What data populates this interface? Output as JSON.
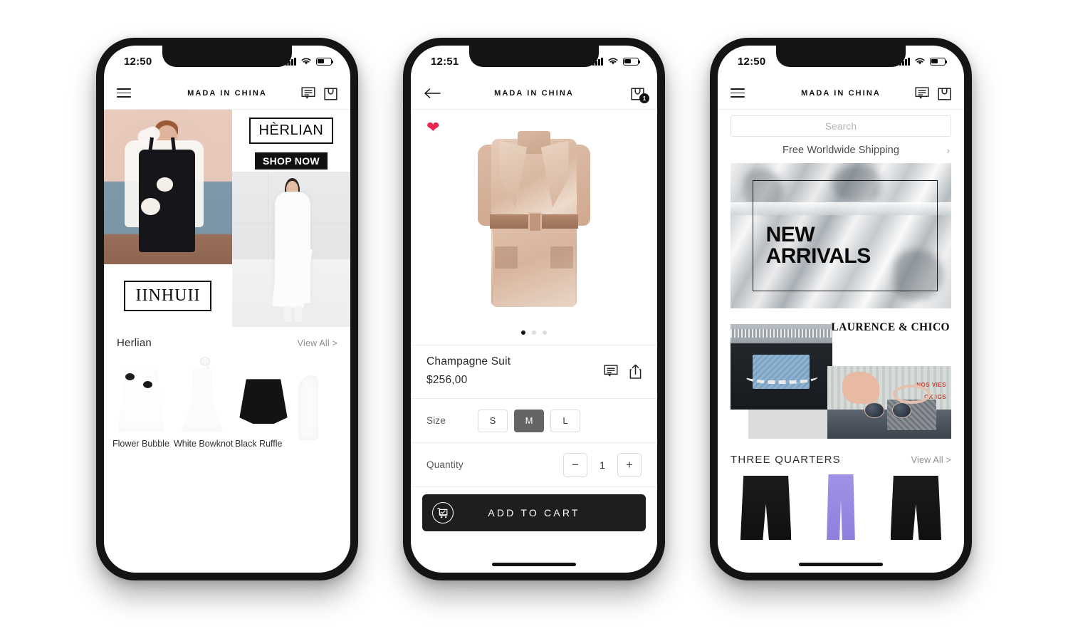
{
  "app": {
    "brand": "MADA IN CHINA"
  },
  "phones": [
    {
      "id": "home",
      "status": {
        "time": "12:50",
        "signal_icon": "cellular-signal-icon",
        "wifi_icon": "wifi-icon",
        "battery_icon": "battery-icon"
      },
      "nav": {
        "menu_icon": "hamburger-menu-icon",
        "brand": "MADA IN CHINA",
        "chat_icon": "chat-bubble-icon",
        "bag_icon": "shopping-bag-icon"
      },
      "hero": {
        "brand_badge": "HÈRLIAN",
        "shop_now": "SHOP NOW",
        "brand_badge_2": "IINHUII",
        "image_1_alt": "model-black-pinafore-dress",
        "image_2_alt": "model-white-ruffle-dress"
      },
      "section": {
        "title": "Herlian",
        "view_all": "View All >",
        "products": [
          {
            "name": "Flower Bubble",
            "image_alt": "white-puff-sleeve-dress"
          },
          {
            "name": "White Bowknot",
            "image_alt": "white-bow-strap-dress"
          },
          {
            "name": "Black Ruffle",
            "image_alt": "black-ruffle-skirt"
          },
          {
            "name": "",
            "image_alt": "white-dress-partial"
          }
        ]
      }
    },
    {
      "id": "product",
      "status": {
        "time": "12:51",
        "signal_icon": "cellular-signal-icon",
        "wifi_icon": "wifi-icon",
        "battery_icon": "battery-icon"
      },
      "nav": {
        "back_icon": "back-arrow-icon",
        "brand": "MADA IN CHINA",
        "bag_icon": "shopping-bag-icon",
        "bag_count": "1"
      },
      "gallery": {
        "favorite_icon": "heart-filled-icon",
        "image_alt": "champagne-satin-belted-suit-dress",
        "dots": 3,
        "active_dot": 0
      },
      "product": {
        "title": "Champagne Suit",
        "price": "$256,00",
        "review_icon": "chat-bubble-icon",
        "share_icon": "share-icon"
      },
      "size": {
        "label": "Size",
        "options": [
          "S",
          "M",
          "L"
        ],
        "selected": "M"
      },
      "quantity": {
        "label": "Quantity",
        "minus": "−",
        "value": "1",
        "plus": "+"
      },
      "cta": {
        "label": "ADD TO CART",
        "icon": "cart-check-icon"
      }
    },
    {
      "id": "discover",
      "status": {
        "time": "12:50",
        "signal_icon": "cellular-signal-icon",
        "wifi_icon": "wifi-icon",
        "battery_icon": "battery-icon"
      },
      "nav": {
        "menu_icon": "hamburger-menu-icon",
        "brand": "MADA IN CHINA",
        "chat_icon": "chat-bubble-icon",
        "bag_icon": "shopping-bag-icon"
      },
      "search": {
        "placeholder": "Search",
        "value": ""
      },
      "shipping": {
        "text": "Free Worldwide Shipping",
        "chevron": "›"
      },
      "banner": {
        "line1": "NEW",
        "line2": "ARRIVALS",
        "image_alt": "silver-foil-texture"
      },
      "collab": {
        "title": "LAURENCE & CHICO",
        "image_1_alt": "blue-monogram-chain-bag",
        "image_2_alt": "hand-holding-bag-and-sunglasses",
        "graffiti_1": "NOS VIES",
        "graffiti_2": "OK IGS"
      },
      "section": {
        "title": "THREE QUARTERS",
        "view_all": "View All >",
        "products": [
          {
            "image_alt": "black-wide-leg-trousers"
          },
          {
            "image_alt": "lavender-straight-jeans"
          },
          {
            "image_alt": "black-slim-trousers"
          }
        ]
      }
    }
  ],
  "colors": {
    "accent_heart": "#e82751",
    "ink": "#141414",
    "selected_chip": "#656565",
    "muted": "#8f8f8f"
  }
}
